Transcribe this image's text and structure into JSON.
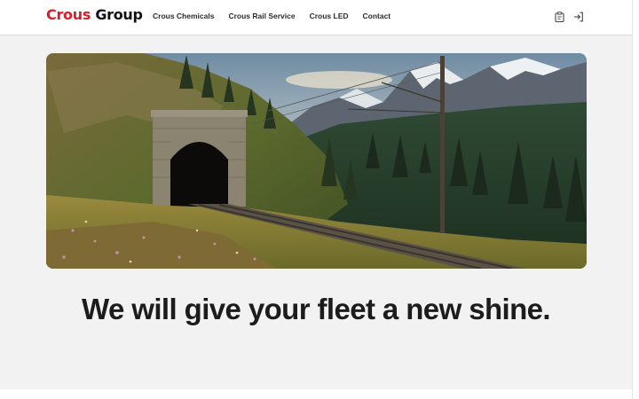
{
  "header": {
    "logo_brand": "Crous",
    "logo_rest": " Group",
    "nav": [
      {
        "label": "Crous Chemicals"
      },
      {
        "label": "Crous Rail Service"
      },
      {
        "label": "Crous LED"
      },
      {
        "label": "Contact"
      }
    ],
    "icons": [
      "clipboard-icon",
      "login-icon"
    ]
  },
  "hero": {
    "image": "railway-tunnel-mountain-photo"
  },
  "main": {
    "headline": "We will give your fleet a new shine."
  },
  "colors": {
    "brand_red": "#d81e28",
    "text_dark": "#1c1c1c",
    "page_bg": "#f2f2f2"
  }
}
